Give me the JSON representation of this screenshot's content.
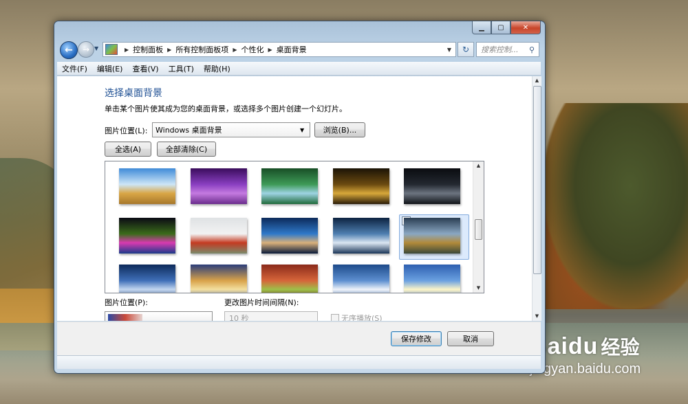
{
  "window": {
    "caption_buttons": [
      "minimize",
      "maximize",
      "close"
    ],
    "close_label": "✕"
  },
  "address_bar": {
    "breadcrumbs": [
      "控制面板",
      "所有控制面板项",
      "个性化",
      "桌面背景"
    ],
    "icon": "control-panel-icon"
  },
  "search": {
    "placeholder": "搜索控制..."
  },
  "menu": [
    "文件(F)",
    "编辑(E)",
    "查看(V)",
    "工具(T)",
    "帮助(H)"
  ],
  "main": {
    "title": "选择桌面背景",
    "description": "单击某个图片使其成为您的桌面背景，或选择多个图片创建一个幻灯片。",
    "location_label": "图片位置(L):",
    "location_value": "Windows 桌面背景",
    "browse_label": "浏览(B)...",
    "select_all_label": "全选(A)",
    "clear_all_label": "全部清除(C)",
    "thumbnails": [
      {
        "name": "wheat-field-sky",
        "colors": [
          "#3f8ad8",
          "#cde6f7",
          "#d9a646",
          "#a7772b"
        ]
      },
      {
        "name": "ladybug-purple-flower",
        "colors": [
          "#3a0d5c",
          "#8a3fc1",
          "#c47ae0",
          "#6a2c8c"
        ]
      },
      {
        "name": "waterfall-green",
        "colors": [
          "#184e26",
          "#3e9a57",
          "#9ed3e3",
          "#1f6a3a"
        ]
      },
      {
        "name": "glowing-orb-dark",
        "colors": [
          "#1b1406",
          "#6b4a10",
          "#d7a83a",
          "#2a1c08"
        ]
      },
      {
        "name": "smoking-cup-dark",
        "colors": [
          "#0a0c10",
          "#232830",
          "#6c7480",
          "#101317"
        ]
      },
      {
        "name": "dancers-light",
        "colors": [
          "#0a0a14",
          "#3b6b1a",
          "#d83ab0",
          "#1a3a8a"
        ]
      },
      {
        "name": "red-poppies",
        "colors": [
          "#dfe2e4",
          "#f2f2f2",
          "#c43a22",
          "#7a8a6a"
        ]
      },
      {
        "name": "boat-sunset-lake",
        "colors": [
          "#0c2a5a",
          "#2f79c9",
          "#d9b07a",
          "#081a3a"
        ]
      },
      {
        "name": "moon-night-snow",
        "colors": [
          "#0c2240",
          "#4f7fb0",
          "#dbe6f2",
          "#1a3558"
        ]
      },
      {
        "name": "lake-autumn-selected",
        "colors": [
          "#2a3d52",
          "#8aa7c2",
          "#b28a3a",
          "#3b4a3a"
        ]
      },
      {
        "name": "blue-light-rays",
        "colors": [
          "#0d2a5a",
          "#3f6fb8",
          "#c4d7f0",
          "#1a3a70"
        ]
      },
      {
        "name": "sunset-clouds",
        "colors": [
          "#2a3d7a",
          "#d9a24a",
          "#f3e0a0",
          "#4a5d9a"
        ]
      },
      {
        "name": "red-leaf-green",
        "colors": [
          "#8a2a1a",
          "#d6653a",
          "#9ec14a",
          "#5a1a10"
        ]
      },
      {
        "name": "sky-sun-white",
        "colors": [
          "#1d4a8a",
          "#5d8fd0",
          "#f0f4fa",
          "#2a5aa0"
        ]
      },
      {
        "name": "sunburst-sky",
        "colors": [
          "#2d5fb0",
          "#6aa0e0",
          "#fff6c8",
          "#3a70c0"
        ]
      }
    ],
    "selected_index": 9,
    "position_label": "图片位置(P):",
    "interval_label": "更改图片时间间隔(N):",
    "interval_value": "10 秒",
    "shuffle_label": "无序播放(S)"
  },
  "footer": {
    "save_label": "保存修改",
    "cancel_label": "取消"
  },
  "watermark": {
    "logo": "Baidu",
    "cn": "经验",
    "url": "jingyan.baidu.com"
  }
}
